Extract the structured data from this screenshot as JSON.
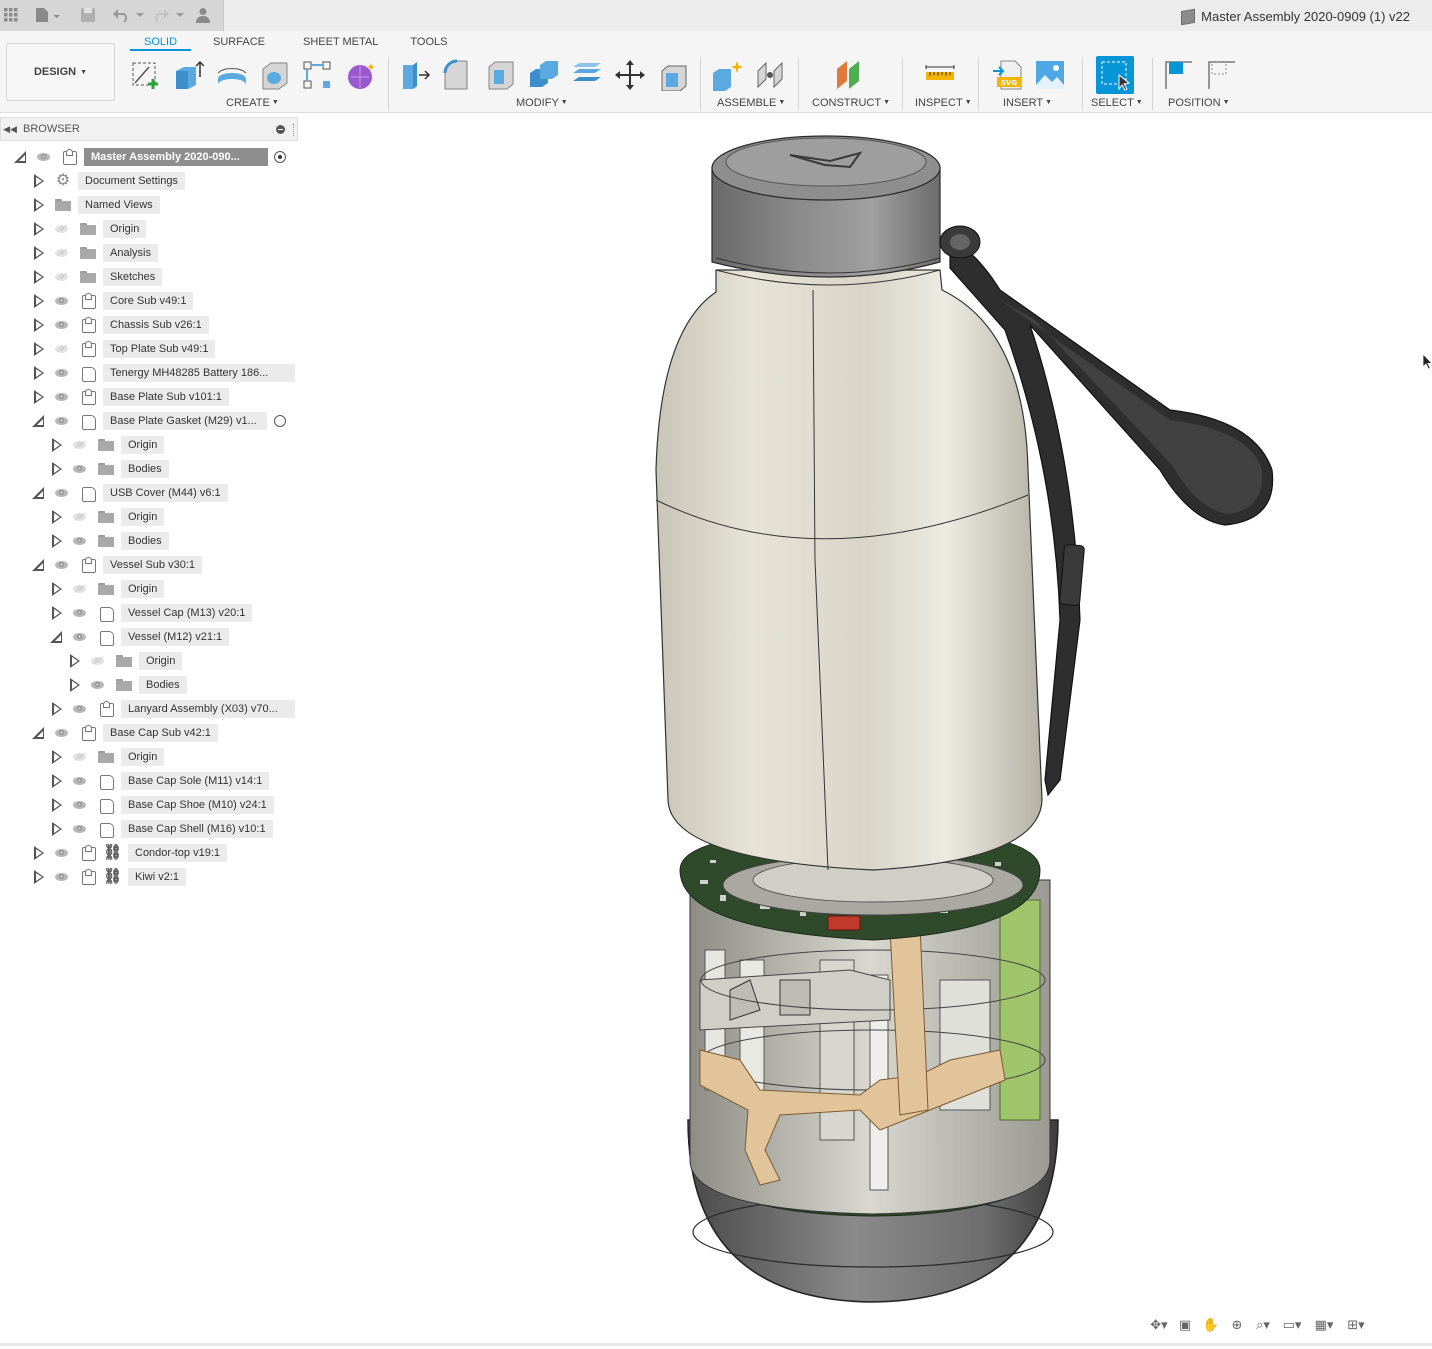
{
  "window": {
    "title": "Master Assembly 2020-0909 (1) v22"
  },
  "workspace": {
    "label": "DESIGN"
  },
  "tabs": [
    "SOLID",
    "SURFACE",
    "SHEET METAL",
    "TOOLS"
  ],
  "groups": {
    "create": "CREATE",
    "modify": "MODIFY",
    "assemble": "ASSEMBLE",
    "construct": "CONSTRUCT",
    "inspect": "INSPECT",
    "insert": "INSERT",
    "select": "SELECT",
    "position": "POSITION"
  },
  "browser": {
    "title": "BROWSER",
    "root": "Master Assembly 2020-090...",
    "items": [
      {
        "label": "Document Settings"
      },
      {
        "label": "Named Views"
      },
      {
        "label": "Origin"
      },
      {
        "label": "Analysis"
      },
      {
        "label": "Sketches"
      },
      {
        "label": "Core Sub v49:1"
      },
      {
        "label": "Chassis Sub v26:1"
      },
      {
        "label": "Top Plate Sub v49:1"
      },
      {
        "label": "Tenergy MH48285 Battery 186..."
      },
      {
        "label": "Base Plate Sub v101:1"
      },
      {
        "label": "Base Plate Gasket (M29) v1..."
      },
      {
        "label": "Origin"
      },
      {
        "label": "Bodies"
      },
      {
        "label": "USB Cover (M44) v6:1"
      },
      {
        "label": "Origin"
      },
      {
        "label": "Bodies"
      },
      {
        "label": "Vessel Sub v30:1"
      },
      {
        "label": "Origin"
      },
      {
        "label": "Vessel Cap (M13) v20:1"
      },
      {
        "label": "Vessel (M12) v21:1"
      },
      {
        "label": "Origin"
      },
      {
        "label": "Bodies"
      },
      {
        "label": "Lanyard Assembly (X03) v70..."
      },
      {
        "label": "Base Cap Sub v42:1"
      },
      {
        "label": "Origin"
      },
      {
        "label": "Base Cap Sole (M11) v14:1"
      },
      {
        "label": "Base Cap Shoe (M10) v24:1"
      },
      {
        "label": "Base Cap Shell (M16) v10:1"
      },
      {
        "label": "Condor-top v19:1"
      },
      {
        "label": "Kiwi v2:1"
      }
    ]
  },
  "colors": {
    "accent": "#0696d7",
    "vessel": "#d9d6c9",
    "cap": "#7a7a7a",
    "pcb": "#2f4a2a",
    "flex": "#e2c49a"
  }
}
